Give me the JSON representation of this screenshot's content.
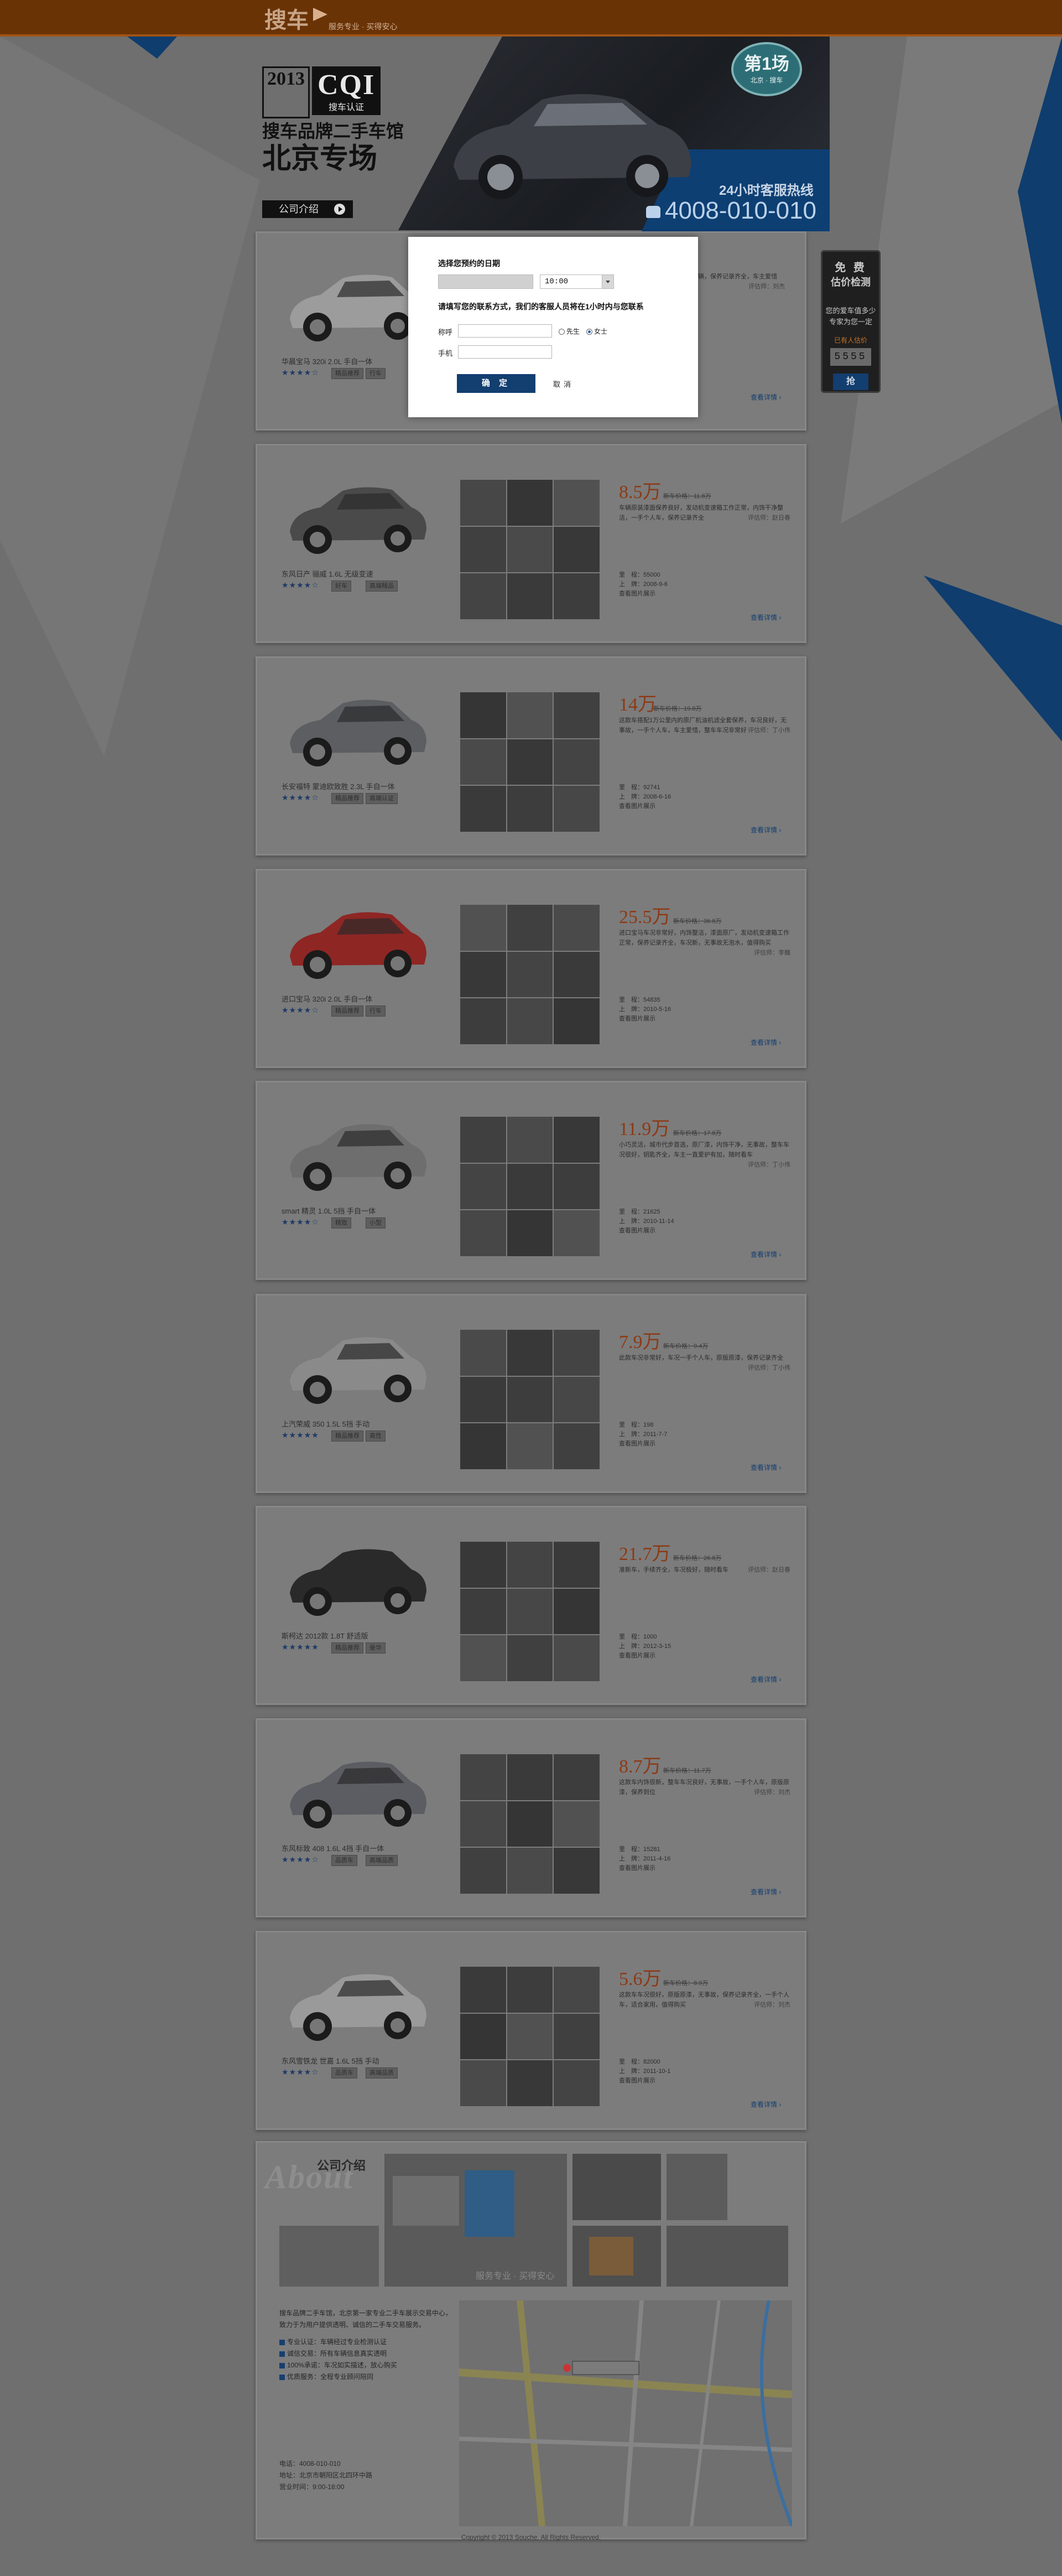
{
  "header": {
    "logo": "搜车",
    "slogan": "服务专业 · 买得安心"
  },
  "banner": {
    "year": "2013",
    "cqi": "CQI",
    "cqi_sub": "搜车认证",
    "title1": "搜车品牌二手车馆",
    "title2": "北京专场",
    "intro_button": "公司介绍",
    "badge_main": "第1场",
    "badge_sub": "北京 · 搜车",
    "hotline_label": "24小时客服热线",
    "hotline": "4008-010-010"
  },
  "side_widget": {
    "line1": "免 费",
    "line2": "估价检测",
    "line3": "您的爱车值多少",
    "line4": "专家为您一定",
    "count_label": "已有人估价",
    "count": "5555",
    "button": "抢"
  },
  "modal": {
    "date_label": "选择您预约的日期",
    "time_value": "10:00",
    "contact_label": "请填写您的联系方式，我们的客服人员将在1小时内与您联系",
    "name_label": "称呼",
    "phone_label": "手机",
    "radio_mr": "先生",
    "radio_ms": "女士",
    "submit": "确 定",
    "cancel": "取消"
  },
  "cars": [
    {
      "name": "华晨宝马 320i 2.0L 手自一体",
      "price": "",
      "guide": "",
      "desc": "车况极佳，原厂漆面，一手车辆，保养记录齐全，车主爱惜",
      "reviewer": "评估师：刘杰",
      "mileage": "",
      "date": "",
      "more": "查看详情 ›",
      "tags": [
        "精品推荐",
        "行车"
      ],
      "stars": "★★★★☆",
      "color": "#9c9c9c"
    },
    {
      "name": "东风日产 骊威 1.6L 无级变速",
      "price": "8.5万",
      "guide": "新车价格：11.8万",
      "desc": "车辆原装漆面保养良好，发动机变速箱工作正常，内饰干净整洁，一手个人车，保养记录齐全",
      "reviewer": "评估师：赵日春",
      "mileage": "里　程：55000",
      "date": "上　牌：2008-9-6",
      "extra": "查看图片展示",
      "more": "查看详情 ›",
      "tags": [
        "好车",
        "高端精品"
      ],
      "stars": "★★★★☆",
      "color": "#4a4a4a"
    },
    {
      "name": "长安福特 蒙迪欧致胜 2.3L 手自一体",
      "price": "14万",
      "guide": "新车价格：19.8万",
      "desc": "这款车搭配1万公里内的原厂机油机滤全套保养，车况良好，无事故，一手个人车，车主爱惜，整车车况非常好",
      "reviewer": "评估师：丁小伟",
      "mileage": "里　程：92741",
      "date": "上　牌：2008-6-16",
      "extra": "查看图片展示",
      "more": "查看详情 ›",
      "tags": [
        "精品推荐",
        "高端认证"
      ],
      "stars": "★★★★☆",
      "color": "#5c5e62"
    },
    {
      "name": "进口宝马 320i 2.0L 手自一体",
      "price": "25.5万",
      "guide": "新车价格：36.8万",
      "desc": "进口宝马车况非常好，内饰整洁，漆面原厂，发动机变速箱工作正常，保养记录齐全，车况新，无事故无泡水，值得购买",
      "reviewer": "评估师：李巍",
      "mileage": "里　程：54835",
      "date": "上　牌：2010-5-16",
      "extra": "查看图片展示",
      "more": "查看详情 ›",
      "tags": [
        "精品推荐",
        "行车"
      ],
      "stars": "★★★★☆",
      "color": "#8e2624"
    },
    {
      "name": "smart 精灵 1.0L 5挡 手自一体",
      "price": "11.9万",
      "guide": "新车价格：17.8万",
      "desc": "小巧灵活，城市代步首选，原厂漆，内饰干净，无事故，整车车况很好，钥匙齐全，车主一直爱护有加，随时看车",
      "reviewer": "评估师：丁小伟",
      "mileage": "里　程：21625",
      "date": "上　牌：2010-11-14",
      "extra": "查看图片展示",
      "more": "查看详情 ›",
      "tags": [
        "精致",
        "小型"
      ],
      "stars": "★★★★☆",
      "color": "#6e6e6e"
    },
    {
      "name": "上汽荣威 350 1.5L 5挡 手动",
      "price": "7.9万",
      "guide": "新车价格：9.4万",
      "desc": "此款车况非常好，车况一手个人车，原版原漆，保养记录齐全",
      "reviewer": "评估师：丁小伟",
      "mileage": "里　程：198",
      "date": "上　牌：2011-7-7",
      "extra": "查看图片展示",
      "more": "查看详情 ›",
      "tags": [
        "精品推荐",
        "高性"
      ],
      "stars": "★★★★★",
      "color": "#8a8a8a"
    },
    {
      "name": "斯柯达 2012款 1.8T 舒适版",
      "price": "21.7万",
      "guide": "新车价格：26.8万",
      "desc": "准新车，手续齐全，车况极好，随时看车",
      "reviewer": "评估师：赵日春",
      "mileage": "里　程：1000",
      "date": "上　牌：2012-3-15",
      "extra": "查看图片展示",
      "more": "查看详情 ›",
      "tags": [
        "精品推荐",
        "豪华"
      ],
      "stars": "★★★★★",
      "color": "#2a2a2a"
    },
    {
      "name": "东风标致 408 1.6L 4挡 手自一体",
      "price": "8.7万",
      "guide": "新车价格：11.7万",
      "desc": "这款车内饰很新，整车车况良好，无事故，一手个人车，原版原漆，保养到位",
      "reviewer": "评估师：刘杰",
      "mileage": "里　程：15281",
      "date": "上　牌：2011-4-16",
      "extra": "查看图片展示",
      "more": "查看详情 ›",
      "tags": [
        "品质车",
        "高端品质"
      ],
      "stars": "★★★★☆",
      "color": "#5b5d62"
    },
    {
      "name": "东风雪铁龙 世嘉 1.6L 5挡 手动",
      "price": "5.6万",
      "guide": "新车价格：8.9万",
      "desc": "这款车车况很好，原版原漆，无事故，保养记录齐全，一手个人车，适合家用，值得购买",
      "reviewer": "评估师：刘杰",
      "mileage": "里　程：82000",
      "date": "上　牌：2011-10-1",
      "extra": "查看图片展示",
      "more": "查看详情 ›",
      "tags": [
        "品质车",
        "高端品质"
      ],
      "stars": "★★★★☆",
      "color": "#9a9a9a"
    }
  ],
  "about": {
    "word": "About",
    "title": "公司介绍",
    "mosaic_caption": "服务专业 · 买得安心",
    "body": "搜车品牌二手车馆，北京第一家专业二手车展示交易中心，致力于为用户提供透明、诚信的二手车交易服务。",
    "points": [
      "专业认证：车辆经过专业检测认证",
      "诚信交易：所有车辆信息真实透明",
      "100%承诺：车况如实描述，放心购买",
      "优质服务：全程专业顾问陪同"
    ],
    "phone": "电话：4008-010-010",
    "address": "地址：北京市朝阳区北四环中路",
    "hours": "营业时间：9:00-18:00"
  },
  "footer": "Copyright © 2013 Souche. All Rights Reserved."
}
